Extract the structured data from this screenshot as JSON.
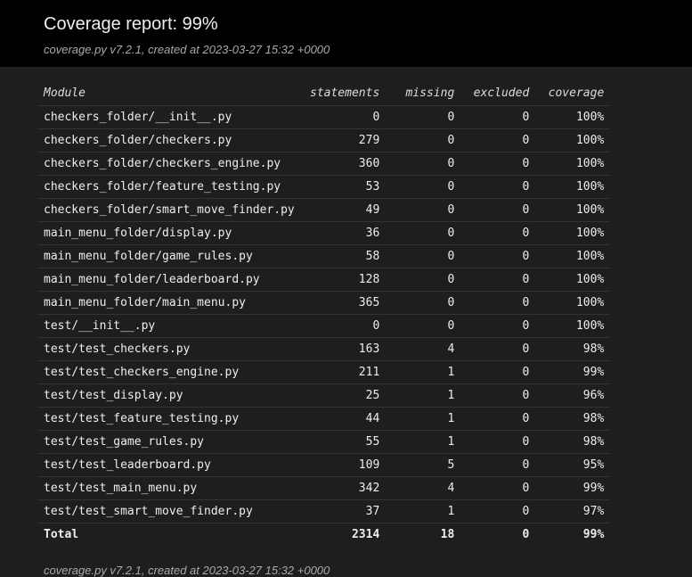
{
  "header": {
    "title": "Coverage report: 99%",
    "created": "coverage.py v7.2.1, created at 2023-03-27 15:32 +0000"
  },
  "table": {
    "columns": [
      "Module",
      "statements",
      "missing",
      "excluded",
      "coverage"
    ],
    "rows": [
      {
        "module": "checkers_folder/__init__.py",
        "statements": "0",
        "missing": "0",
        "excluded": "0",
        "coverage": "100%"
      },
      {
        "module": "checkers_folder/checkers.py",
        "statements": "279",
        "missing": "0",
        "excluded": "0",
        "coverage": "100%"
      },
      {
        "module": "checkers_folder/checkers_engine.py",
        "statements": "360",
        "missing": "0",
        "excluded": "0",
        "coverage": "100%"
      },
      {
        "module": "checkers_folder/feature_testing.py",
        "statements": "53",
        "missing": "0",
        "excluded": "0",
        "coverage": "100%"
      },
      {
        "module": "checkers_folder/smart_move_finder.py",
        "statements": "49",
        "missing": "0",
        "excluded": "0",
        "coverage": "100%"
      },
      {
        "module": "main_menu_folder/display.py",
        "statements": "36",
        "missing": "0",
        "excluded": "0",
        "coverage": "100%"
      },
      {
        "module": "main_menu_folder/game_rules.py",
        "statements": "58",
        "missing": "0",
        "excluded": "0",
        "coverage": "100%"
      },
      {
        "module": "main_menu_folder/leaderboard.py",
        "statements": "128",
        "missing": "0",
        "excluded": "0",
        "coverage": "100%"
      },
      {
        "module": "main_menu_folder/main_menu.py",
        "statements": "365",
        "missing": "0",
        "excluded": "0",
        "coverage": "100%"
      },
      {
        "module": "test/__init__.py",
        "statements": "0",
        "missing": "0",
        "excluded": "0",
        "coverage": "100%"
      },
      {
        "module": "test/test_checkers.py",
        "statements": "163",
        "missing": "4",
        "excluded": "0",
        "coverage": "98%"
      },
      {
        "module": "test/test_checkers_engine.py",
        "statements": "211",
        "missing": "1",
        "excluded": "0",
        "coverage": "99%"
      },
      {
        "module": "test/test_display.py",
        "statements": "25",
        "missing": "1",
        "excluded": "0",
        "coverage": "96%"
      },
      {
        "module": "test/test_feature_testing.py",
        "statements": "44",
        "missing": "1",
        "excluded": "0",
        "coverage": "98%"
      },
      {
        "module": "test/test_game_rules.py",
        "statements": "55",
        "missing": "1",
        "excluded": "0",
        "coverage": "98%"
      },
      {
        "module": "test/test_leaderboard.py",
        "statements": "109",
        "missing": "5",
        "excluded": "0",
        "coverage": "95%"
      },
      {
        "module": "test/test_main_menu.py",
        "statements": "342",
        "missing": "4",
        "excluded": "0",
        "coverage": "99%"
      },
      {
        "module": "test/test_smart_move_finder.py",
        "statements": "37",
        "missing": "1",
        "excluded": "0",
        "coverage": "97%"
      }
    ],
    "total": {
      "module": "Total",
      "statements": "2314",
      "missing": "18",
      "excluded": "0",
      "coverage": "99%"
    }
  },
  "footer": {
    "created": "coverage.py v7.2.1, created at 2023-03-27 15:32 +0000"
  },
  "colors": {
    "page_background": "#1e1e1e",
    "header_background": "#000000",
    "text": "#eeeeee",
    "muted_text": "#aaaaaa",
    "row_divider": "#333333"
  }
}
